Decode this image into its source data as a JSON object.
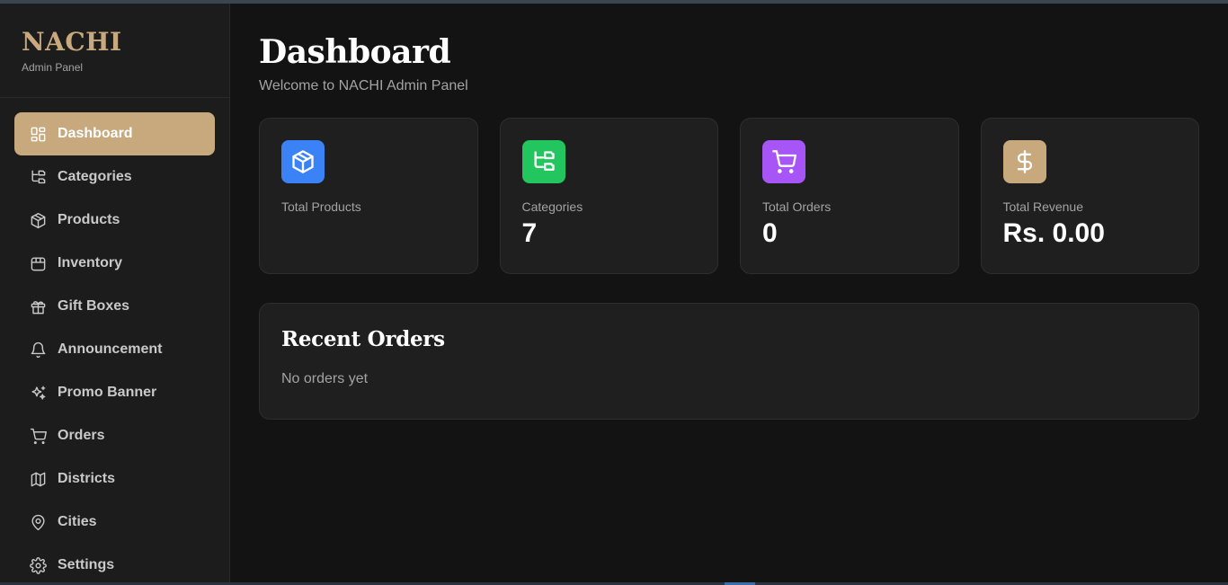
{
  "brand": {
    "title": "NACHI",
    "subtitle": "Admin Panel"
  },
  "sidebar": {
    "items": [
      {
        "label": "Dashboard",
        "icon": "layout-grid-icon",
        "active": true
      },
      {
        "label": "Categories",
        "icon": "folder-tree-icon"
      },
      {
        "label": "Products",
        "icon": "package-icon"
      },
      {
        "label": "Inventory",
        "icon": "box-icon"
      },
      {
        "label": "Gift Boxes",
        "icon": "gift-icon"
      },
      {
        "label": "Announcement",
        "icon": "bell-icon"
      },
      {
        "label": "Promo Banner",
        "icon": "sparkles-icon"
      },
      {
        "label": "Orders",
        "icon": "cart-icon"
      },
      {
        "label": "Districts",
        "icon": "map-icon"
      },
      {
        "label": "Cities",
        "icon": "map-pin-icon"
      },
      {
        "label": "Settings",
        "icon": "gear-icon"
      }
    ]
  },
  "header": {
    "title": "Dashboard",
    "subtitle": "Welcome to NACHI Admin Panel"
  },
  "stats": [
    {
      "label": "Total Products",
      "value": "",
      "icon": "package-icon",
      "color": "#3b82f6"
    },
    {
      "label": "Categories",
      "value": "7",
      "icon": "folder-tree-icon",
      "color": "#22c55e"
    },
    {
      "label": "Total Orders",
      "value": "0",
      "icon": "cart-icon",
      "color": "#a855f7"
    },
    {
      "label": "Total Revenue",
      "value": "Rs. 0.00",
      "icon": "dollar-icon",
      "color": "#c8a97e"
    }
  ],
  "recent_orders": {
    "title": "Recent Orders",
    "empty_text": "No orders yet"
  },
  "colors": {
    "accent": "#c8a97e",
    "background": "#131313",
    "sidebar": "#1c1c1c",
    "card": "#1f1f1f"
  }
}
